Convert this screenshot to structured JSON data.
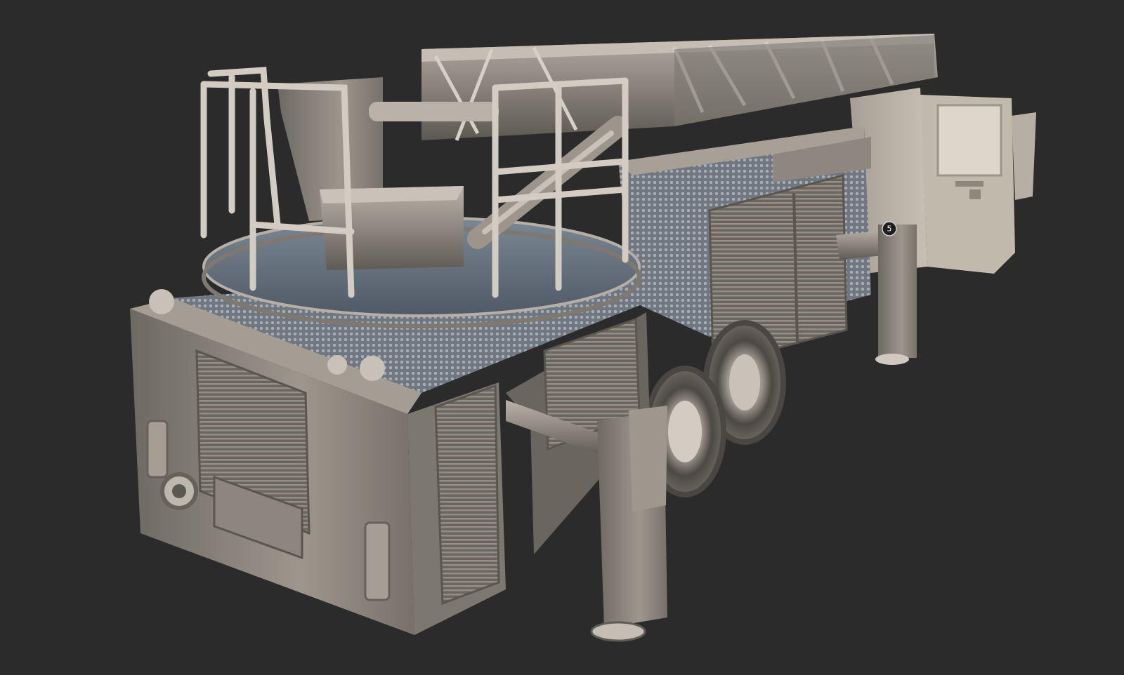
{
  "viewer": {
    "background": "#2b2b2b",
    "model_color": "#8f8a83",
    "model_shadow": "#5c5853",
    "model_highlight": "#c9c4bc",
    "sky_tint": "#5a6a78"
  },
  "hotspots": [
    {
      "label": "5",
      "bg": "#1e1e1e",
      "fg": "#ffffff"
    }
  ]
}
